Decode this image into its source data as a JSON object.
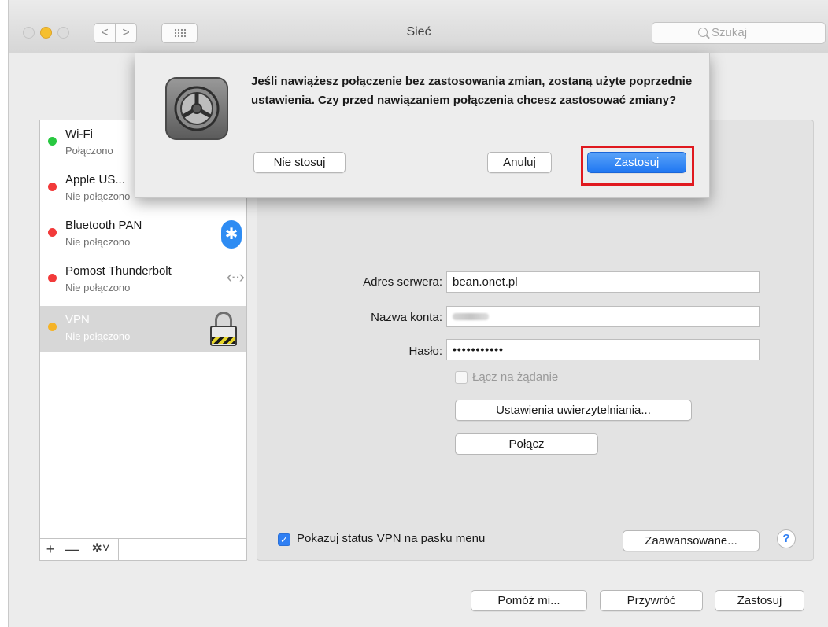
{
  "window": {
    "title": "Sieć",
    "search_placeholder": "Szukaj",
    "nav_back": "<",
    "nav_forward": ">"
  },
  "sidebar": {
    "items": [
      {
        "name": "Wi-Fi",
        "status": "Połączono",
        "dot_color": "#28c840"
      },
      {
        "name": "Apple US...",
        "status": "Nie połączono",
        "dot_color": "#f23a3a"
      },
      {
        "name": "Bluetooth PAN",
        "status": "Nie połączono",
        "dot_color": "#f23a3a",
        "icon": "bluetooth-icon"
      },
      {
        "name": "Pomost Thunderbolt",
        "status": "Nie połączono",
        "dot_color": "#f23a3a",
        "icon": "thunderbolt-bridge-icon"
      },
      {
        "name": "VPN",
        "status": "Nie połączono",
        "dot_color": "#f5b327",
        "icon": "vpn-lock-icon",
        "selected": true
      }
    ],
    "toolbar": {
      "add": "+",
      "remove": "—",
      "gear": "✲˅"
    }
  },
  "form": {
    "server_label": "Adres serwera:",
    "server_value": "bean.onet.pl",
    "account_label": "Nazwa konta:",
    "password_label": "Hasło:",
    "password_value": "•••••••••••",
    "connect_on_demand_label": "Łącz na żądanie",
    "connect_on_demand_checked": false,
    "auth_settings_button": "Ustawienia uwierzytelniania...",
    "connect_button": "Połącz",
    "show_vpn_status_label": "Pokazuj status VPN na pasku menu",
    "show_vpn_status_checked": true,
    "advanced_button": "Zaawansowane...",
    "help_button": "?"
  },
  "footer": {
    "assist_button": "Pomóż mi...",
    "revert_button": "Przywróć",
    "apply_button": "Zastosuj"
  },
  "dialog": {
    "message": "Jeśli nawiążesz połączenie bez zastosowania zmian, zostaną użyte poprzednie ustawienia. Czy przed nawiązaniem połączenia chcesz zastosować zmiany?",
    "dont_apply_button": "Nie stosuj",
    "cancel_button": "Anuluj",
    "apply_button": "Zastosuj",
    "highlight_color": "#e0191f"
  }
}
